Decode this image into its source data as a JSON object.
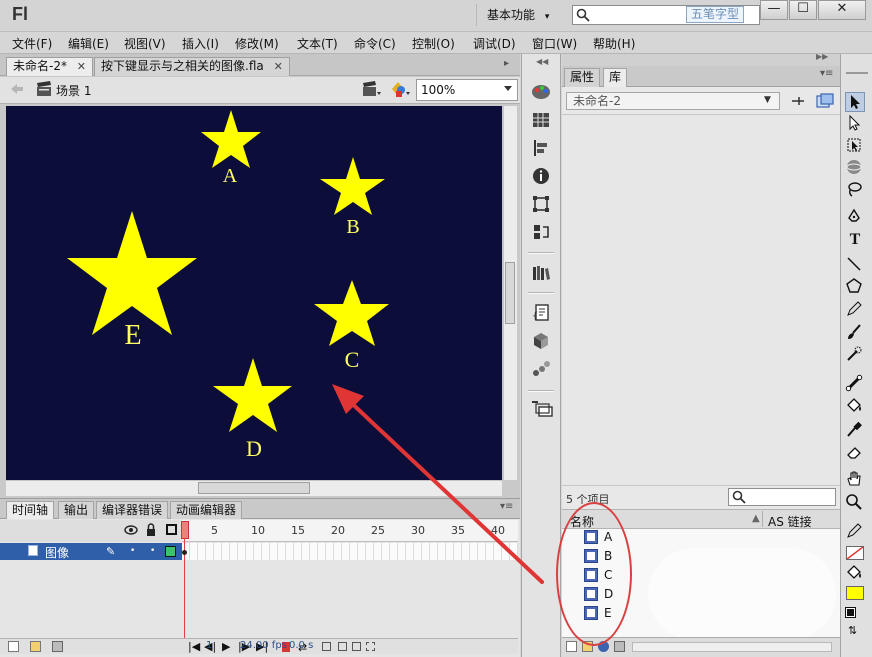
{
  "app": {
    "logo": "Fl",
    "workspace": "基本功能",
    "watermark": "五笔字型",
    "window_buttons": [
      "—",
      "☐",
      "✕"
    ]
  },
  "menu": [
    "文件(F)",
    "编辑(E)",
    "视图(V)",
    "插入(I)",
    "修改(M)",
    "文本(T)",
    "命令(C)",
    "控制(O)",
    "调试(D)",
    "窗口(W)",
    "帮助(H)"
  ],
  "doc_tabs": [
    {
      "label": "未命名-2*",
      "close": "✕"
    },
    {
      "label": "按下键显示与之相关的图像.fla",
      "close": "✕"
    }
  ],
  "scene": {
    "label": "场景 1",
    "zoom": "100%"
  },
  "stage": {
    "background": "#0d0d3a",
    "star_color": "#ffff00",
    "stars": [
      {
        "label": "A",
        "size": "small"
      },
      {
        "label": "B",
        "size": "small"
      },
      {
        "label": "C",
        "size": "small"
      },
      {
        "label": "D",
        "size": "small"
      },
      {
        "label": "E",
        "size": "large"
      }
    ]
  },
  "timeline": {
    "tabs": [
      "时间轴",
      "输出",
      "编译器错误",
      "动画编辑器"
    ],
    "frame_numbers": [
      "1",
      "5",
      "10",
      "15",
      "20",
      "25",
      "30",
      "35",
      "40"
    ],
    "layer_name": "图像",
    "current_frame": "1",
    "fps": "24.00 fps",
    "time": "0.0 s"
  },
  "library": {
    "tabs": [
      "属性",
      "库"
    ],
    "document": "未命名-2",
    "item_count": "5 个项目",
    "col_name": "名称",
    "col_link": "AS 链接",
    "items": [
      "A",
      "B",
      "C",
      "D",
      "E"
    ]
  },
  "colors": {
    "annotation": "#d94040",
    "layer_highlight": "#2f5fa8",
    "fill": "#ffff00"
  },
  "icons": [
    "search-icon",
    "back-arrow-icon",
    "scene-clapper-icon",
    "edit-scene-icon",
    "edit-symbol-icon",
    "selection-tool-icon",
    "subselection-tool-icon",
    "free-transform-icon",
    "3d-rotation-icon",
    "lasso-icon",
    "pen-icon",
    "text-icon",
    "line-icon",
    "rectangle-icon",
    "pencil-icon",
    "brush-icon",
    "deco-icon",
    "bone-icon",
    "paint-bucket-icon",
    "eyedropper-icon",
    "eraser-icon",
    "hand-icon",
    "zoom-icon",
    "eye-icon",
    "lock-icon",
    "outline-icon",
    "play-icon"
  ]
}
